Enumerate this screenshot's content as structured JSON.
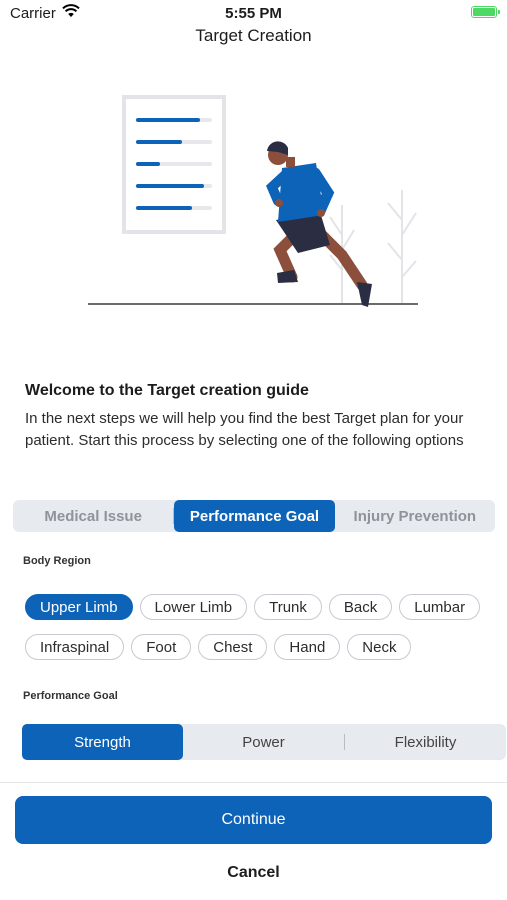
{
  "status_bar": {
    "carrier": "Carrier",
    "time": "5:55 PM"
  },
  "nav": {
    "title": "Target Creation"
  },
  "welcome": {
    "title": "Welcome to the Target creation guide",
    "text": "In the next steps we will help you find the best Target plan for your patient. Start this process by selecting one of the following options"
  },
  "target_type": {
    "options": [
      "Medical Issue",
      "Performance Goal",
      "Injury Prevention"
    ],
    "selected": "Performance Goal"
  },
  "body_region": {
    "label": "Body Region",
    "row1": [
      "Upper Limb",
      "Lower Limb",
      "Trunk",
      "Back",
      "Lumbar"
    ],
    "row2": [
      "Infraspinal",
      "Foot",
      "Chest",
      "Hand",
      "Neck"
    ],
    "selected": "Upper Limb"
  },
  "performance_goal": {
    "label": "Performance Goal",
    "options": [
      "Strength",
      "Power",
      "Flexibility"
    ],
    "selected": "Strength"
  },
  "actions": {
    "continue": "Continue",
    "cancel": "Cancel"
  },
  "colors": {
    "accent": "#0d63b8",
    "segment_bg": "#e7eaee",
    "battery": "#4cd964",
    "figure_skin": "#8b4f3c",
    "figure_shirt": "#0d63b8"
  }
}
